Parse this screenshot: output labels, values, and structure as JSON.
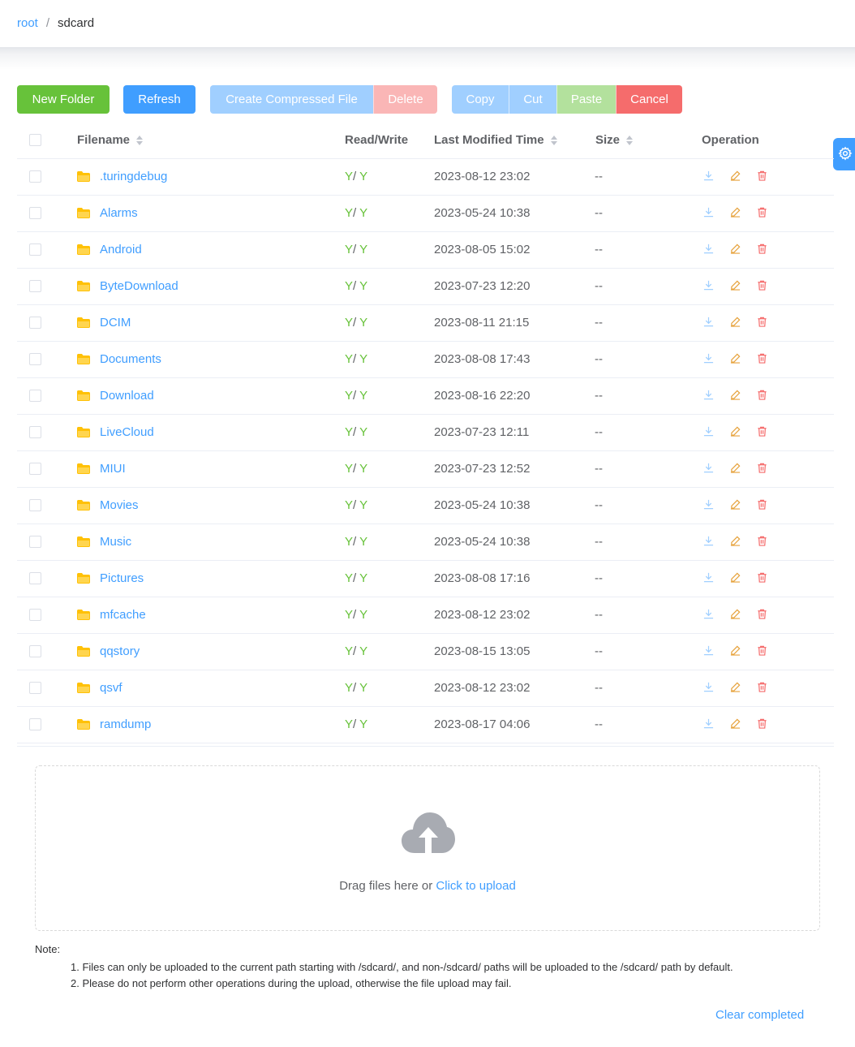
{
  "breadcrumb": {
    "root": "root",
    "separator": "/",
    "current": "sdcard"
  },
  "toolbar": {
    "new_folder": "New Folder",
    "refresh": "Refresh",
    "create_compressed": "Create Compressed File",
    "delete": "Delete",
    "copy": "Copy",
    "cut": "Cut",
    "paste": "Paste",
    "cancel": "Cancel"
  },
  "table": {
    "headers": {
      "filename": "Filename",
      "read_write": "Read/Write",
      "last_modified": "Last Modified Time",
      "size": "Size",
      "operation": "Operation"
    },
    "rows": [
      {
        "name": ".turingdebug",
        "read": "Y",
        "write": "Y",
        "time": "2023-08-12 23:02",
        "size": "--"
      },
      {
        "name": "Alarms",
        "read": "Y",
        "write": "Y",
        "time": "2023-05-24 10:38",
        "size": "--"
      },
      {
        "name": "Android",
        "read": "Y",
        "write": "Y",
        "time": "2023-08-05 15:02",
        "size": "--"
      },
      {
        "name": "ByteDownload",
        "read": "Y",
        "write": "Y",
        "time": "2023-07-23 12:20",
        "size": "--"
      },
      {
        "name": "DCIM",
        "read": "Y",
        "write": "Y",
        "time": "2023-08-11 21:15",
        "size": "--"
      },
      {
        "name": "Documents",
        "read": "Y",
        "write": "Y",
        "time": "2023-08-08 17:43",
        "size": "--"
      },
      {
        "name": "Download",
        "read": "Y",
        "write": "Y",
        "time": "2023-08-16 22:20",
        "size": "--"
      },
      {
        "name": "LiveCloud",
        "read": "Y",
        "write": "Y",
        "time": "2023-07-23 12:11",
        "size": "--"
      },
      {
        "name": "MIUI",
        "read": "Y",
        "write": "Y",
        "time": "2023-07-23 12:52",
        "size": "--"
      },
      {
        "name": "Movies",
        "read": "Y",
        "write": "Y",
        "time": "2023-05-24 10:38",
        "size": "--"
      },
      {
        "name": "Music",
        "read": "Y",
        "write": "Y",
        "time": "2023-05-24 10:38",
        "size": "--"
      },
      {
        "name": "Pictures",
        "read": "Y",
        "write": "Y",
        "time": "2023-08-08 17:16",
        "size": "--"
      },
      {
        "name": "mfcache",
        "read": "Y",
        "write": "Y",
        "time": "2023-08-12 23:02",
        "size": "--"
      },
      {
        "name": "qqstory",
        "read": "Y",
        "write": "Y",
        "time": "2023-08-15 13:05",
        "size": "--"
      },
      {
        "name": "qsvf",
        "read": "Y",
        "write": "Y",
        "time": "2023-08-12 23:02",
        "size": "--"
      },
      {
        "name": "ramdump",
        "read": "Y",
        "write": "Y",
        "time": "2023-08-17 04:06",
        "size": "--"
      }
    ]
  },
  "upload": {
    "text": "Drag files here or ",
    "link": "Click to upload",
    "icon": "cloud-upload-icon"
  },
  "note": {
    "label": "Note:",
    "items": [
      "1. Files can only be uploaded to the current path starting with /sdcard/, and non-/sdcard/ paths will be uploaded to the /sdcard/ path by default.",
      "2. Please do not perform other operations during the upload, otherwise the file upload may fail."
    ]
  },
  "clear_completed": "Clear completed",
  "colors": {
    "primary": "#409eff",
    "success": "#67c23a",
    "danger": "#f56c6c",
    "warning": "#e6a23c",
    "folder": "#ffc107"
  },
  "icons": {
    "folder": "folder-icon",
    "download": "download-icon",
    "rename": "edit-icon",
    "delete": "trash-icon",
    "settings": "gear-icon"
  }
}
